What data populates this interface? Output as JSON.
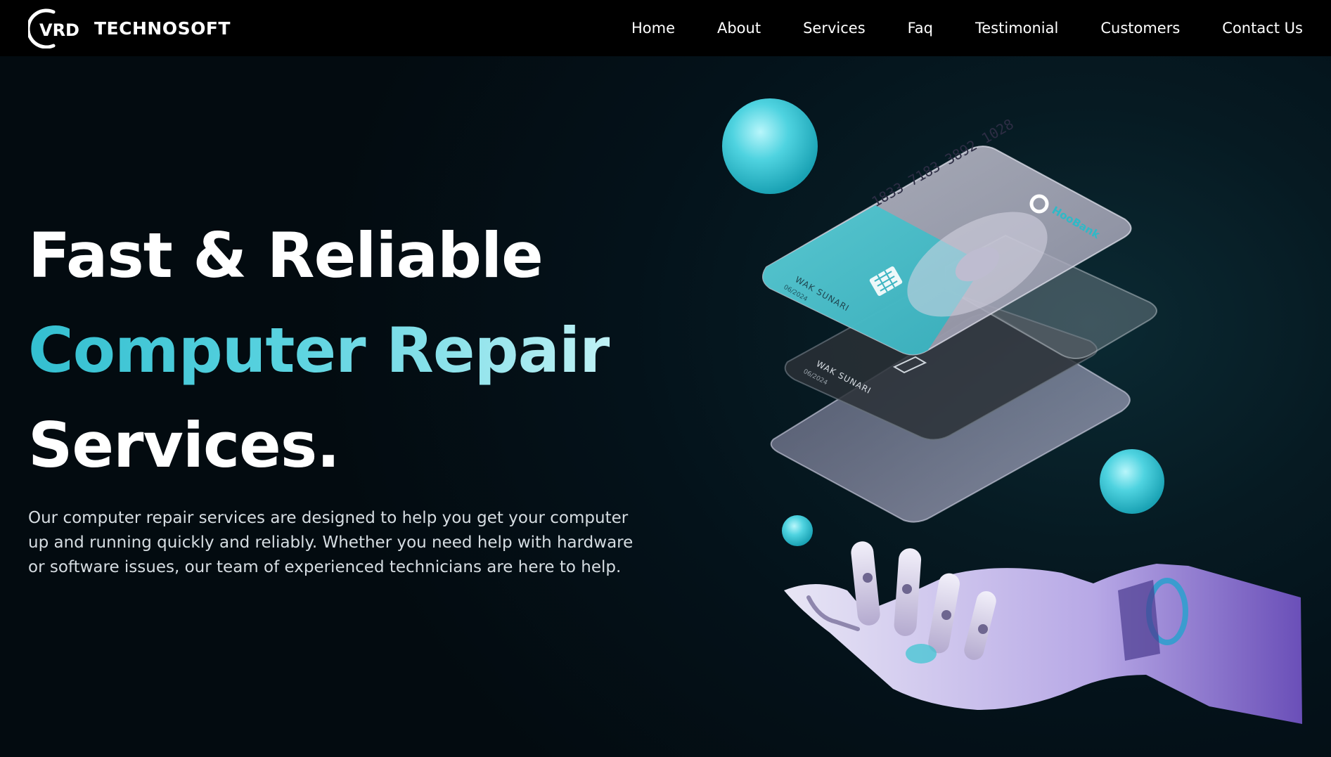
{
  "brand": {
    "logo_text": "TECHNOSOFT",
    "logo_mark": "VRD"
  },
  "nav": {
    "items": [
      {
        "label": "Home"
      },
      {
        "label": "About"
      },
      {
        "label": "Services"
      },
      {
        "label": "Faq"
      },
      {
        "label": "Testimonial"
      },
      {
        "label": "Customers"
      },
      {
        "label": "Contact Us"
      }
    ]
  },
  "hero": {
    "headline_line1": "Fast & Reliable",
    "headline_line2": "Computer Repair",
    "headline_line3": "Services.",
    "description": "Our computer repair services are designed to help you get your computer up and running quickly and reliably. Whether you need help with hardware or software issues, our team of experienced technicians are here to help.",
    "card_number": "1833 7183 3892 1028",
    "card_brand": "HooBank",
    "card_holder_front": "WAK SUNARI",
    "card_expiry_front": "06/2024",
    "card_holder_back": "WAK SUNARI",
    "card_expiry_back": "06/2024"
  },
  "colors": {
    "accent": "#3cc8d8",
    "background": "#000000",
    "hero_bg": "#04121a"
  },
  "icons": {
    "logo": "vrd-logo-icon",
    "robot_hand": "robot-hand-illustration",
    "cards": "credit-cards-illustration"
  }
}
